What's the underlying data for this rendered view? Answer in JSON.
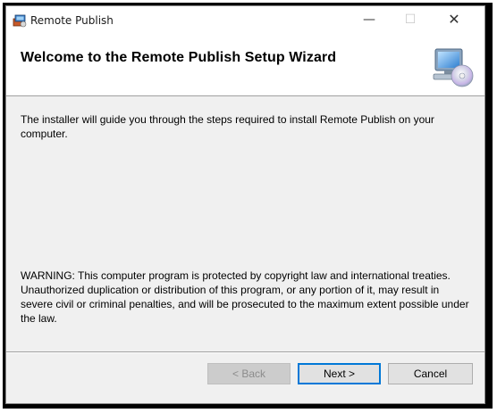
{
  "window": {
    "title": "Remote Publish",
    "controls": {
      "minimize": "—",
      "maximize": "☐",
      "close": "✕"
    }
  },
  "banner": {
    "title": "Welcome to the Remote Publish Setup Wizard"
  },
  "body": {
    "intro": "The installer will guide you through the steps required to install Remote Publish on your computer.",
    "warning": "WARNING: This computer program is protected by copyright law and international treaties. Unauthorized duplication or distribution of this program, or any portion of it, may result in severe civil or criminal penalties, and will be prosecuted to the maximum extent possible under the law."
  },
  "footer": {
    "back_label": "< Back",
    "next_label": "Next >",
    "cancel_label": "Cancel",
    "back_enabled": false
  },
  "colors": {
    "accent": "#0078d7",
    "dialog_bg": "#f0f0f0",
    "banner_bg": "#ffffff"
  },
  "icons": {
    "app": "installer-icon",
    "banner": "computer-cd-icon"
  }
}
